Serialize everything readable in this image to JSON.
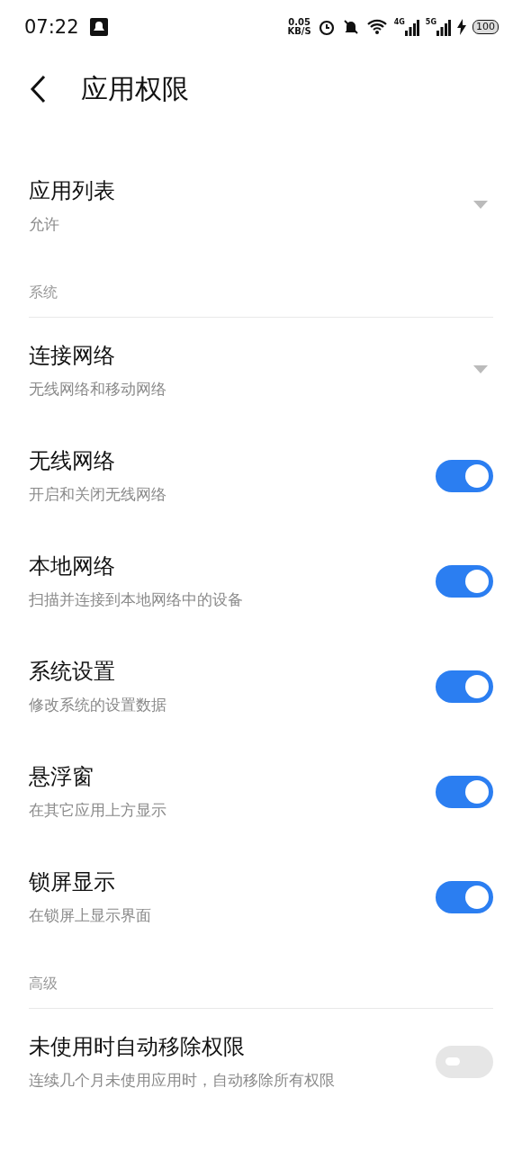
{
  "status_bar": {
    "time": "07:22",
    "speed_value": "0.05",
    "speed_unit": "KB/S",
    "network_1": "4G",
    "network_2": "5G",
    "battery": "100"
  },
  "header": {
    "title": "应用权限"
  },
  "sections": [
    {
      "items": [
        {
          "kind": "dropdown",
          "title": "应用列表",
          "subtitle": "允许"
        }
      ]
    },
    {
      "heading": "系统",
      "items": [
        {
          "kind": "dropdown",
          "title": "连接网络",
          "subtitle": "无线网络和移动网络"
        },
        {
          "kind": "toggle",
          "title": "无线网络",
          "subtitle": "开启和关闭无线网络",
          "on": true
        },
        {
          "kind": "toggle",
          "title": "本地网络",
          "subtitle": "扫描并连接到本地网络中的设备",
          "on": true
        },
        {
          "kind": "toggle",
          "title": "系统设置",
          "subtitle": "修改系统的设置数据",
          "on": true
        },
        {
          "kind": "toggle",
          "title": "悬浮窗",
          "subtitle": "在其它应用上方显示",
          "on": true
        },
        {
          "kind": "toggle",
          "title": "锁屏显示",
          "subtitle": "在锁屏上显示界面",
          "on": true
        }
      ]
    },
    {
      "heading": "高级",
      "items": [
        {
          "kind": "toggle",
          "title": "未使用时自动移除权限",
          "subtitle": "连续几个月未使用应用时，自动移除所有权限",
          "on": false
        }
      ]
    }
  ]
}
